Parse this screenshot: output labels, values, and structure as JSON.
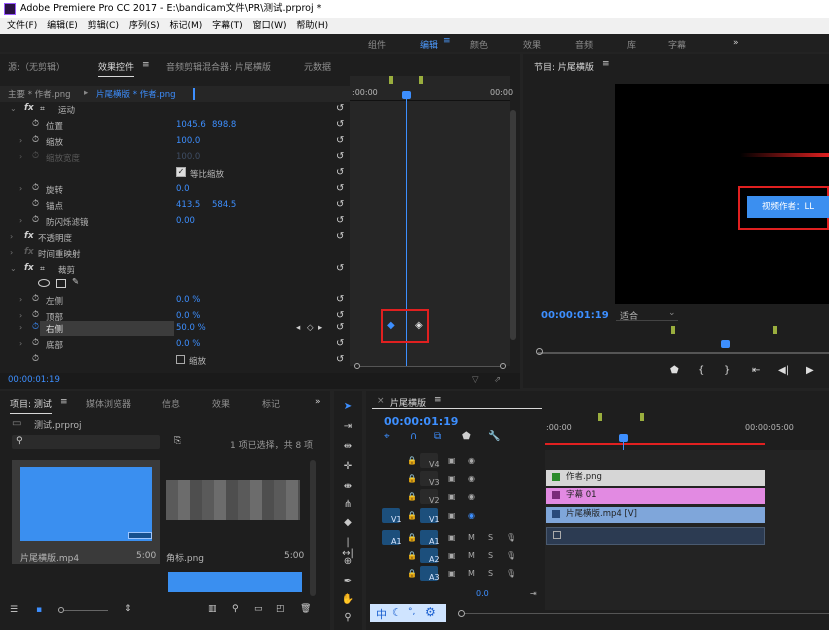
{
  "window": {
    "title": "Adobe Premiere Pro CC 2017 - E:\\bandicam文件\\PR\\测试.prproj *"
  },
  "menu": [
    "文件(F)",
    "编辑(E)",
    "剪辑(C)",
    "序列(S)",
    "标记(M)",
    "字幕(T)",
    "窗口(W)",
    "帮助(H)"
  ],
  "workspaces": {
    "items": [
      "组件",
      "编辑",
      "颜色",
      "效果",
      "音频",
      "库",
      "字幕"
    ],
    "active": "编辑",
    "more": "»"
  },
  "source_tabs": [
    "源:（无剪辑）",
    "效果控件",
    "音频剪辑混合器: 片尾横版",
    "元数据"
  ],
  "effect_controls": {
    "master": "主要 * 作者.png",
    "clip": "片尾横版 * 作者.png",
    "ruler_start": ":00:00",
    "ruler_end": "00:00",
    "motion": "运动",
    "position_label": "位置",
    "position_x": "1045.6",
    "position_y": "898.8",
    "scale_label": "缩放",
    "scale_value": "100.0",
    "scale_width_label": "缩放宽度",
    "scale_width_value": "100.0",
    "uniform_scale": "等比缩放",
    "rotation_label": "旋转",
    "rotation_value": "0.0",
    "anchor_label": "锚点",
    "anchor_x": "413.5",
    "anchor_y": "584.5",
    "antiflicker_label": "防闪烁滤镜",
    "antiflicker_value": "0.00",
    "opacity": "不透明度",
    "time_remap": "时间重映射",
    "crop": "裁剪",
    "left_label": "左侧",
    "left_value": "0.0 %",
    "top_label": "顶部",
    "top_value": "0.0 %",
    "right_label": "右侧",
    "right_value": "50.0 %",
    "bottom_label": "底部",
    "bottom_value": "0.0 %",
    "zoom_label": "缩放",
    "timecode": "00:00:01:19"
  },
  "program": {
    "title": "节目: 片尾横版",
    "timecode": "00:00:01:19",
    "fit": "适合",
    "overlay_text": "视频作者：LL"
  },
  "project": {
    "tabs": [
      "项目: 测试",
      "媒体浏览器",
      "信息",
      "效果",
      "标记"
    ],
    "file": "测试.prproj",
    "selection_info": "1 项已选择，共 8 项",
    "items": [
      {
        "name": "片尾横版.mp4",
        "duration": "5:00"
      },
      {
        "name": "角标.png",
        "duration": "5:00"
      }
    ]
  },
  "timeline": {
    "title": "片尾横版",
    "timecode": "00:00:01:19",
    "ruler_start": ":00:00",
    "ruler_end": "00:00:05:00",
    "video_tracks": [
      "V4",
      "V3",
      "V2",
      "V1"
    ],
    "audio_tracks": [
      "A1",
      "A2",
      "A3"
    ],
    "source_v": "V1",
    "source_a": "A1",
    "clips": {
      "v3": "作者.png",
      "v2": "字幕 01",
      "v1": "片尾横版.mp4 [V]"
    },
    "master_value": "0.0",
    "m_label": "M",
    "s_label": "S"
  },
  "ime": {
    "lang": "中"
  },
  "colors": {
    "accent": "#4d9bff",
    "selection": "#e02020",
    "v3_clip": "#d6d6d6",
    "v2_clip": "#e28ae2",
    "v1_clip": "#7fa6da",
    "a1_clip": "#2c3b52"
  }
}
